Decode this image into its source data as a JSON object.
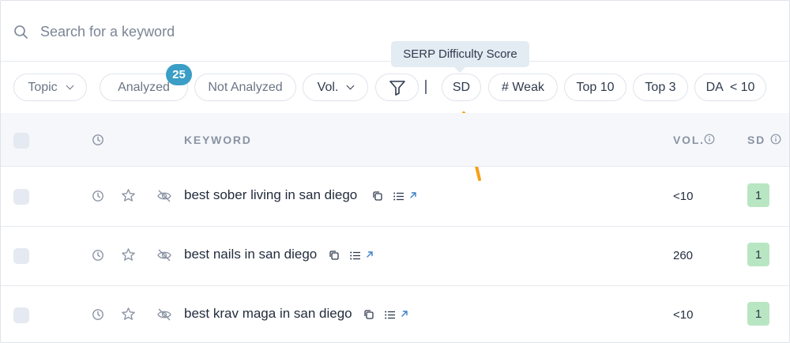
{
  "search": {
    "placeholder": "Search for a keyword"
  },
  "tooltip": {
    "text": "SERP Difficulty Score"
  },
  "filters": {
    "topic": "Topic",
    "analyzed": "Analyzed",
    "analyzed_count": "25",
    "not_analyzed": "Not Analyzed",
    "vol": "Vol.",
    "sd": "SD",
    "weak": "# Weak",
    "top10": "Top 10",
    "top3": "Top 3",
    "da": "DA",
    "da_value": "< 10"
  },
  "table": {
    "headers": {
      "keyword": "KEYWORD",
      "vol": "VOL.",
      "sd": "SD"
    },
    "rows": [
      {
        "keyword": "best sober living in san diego",
        "vol": "<10",
        "sd": "1"
      },
      {
        "keyword": "best nails in san diego",
        "vol": "260",
        "sd": "1"
      },
      {
        "keyword": "best krav maga in san diego",
        "vol": "<10",
        "sd": "1"
      }
    ]
  },
  "colors": {
    "accent_badge": "#3a9ec6",
    "sd_easy": "#b8e6c2",
    "annotation_arrow": "#f5a017"
  },
  "icons": [
    "search-icon",
    "chevron-down-icon",
    "filter-icon",
    "clock-icon",
    "star-icon",
    "eye-off-icon",
    "copy-icon",
    "list-icon",
    "external-link-icon",
    "info-icon",
    "arrow-annotation"
  ]
}
